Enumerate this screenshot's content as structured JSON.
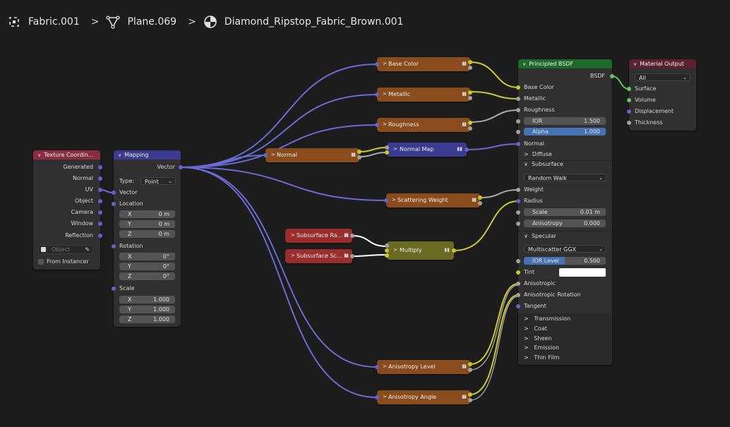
{
  "breadcrumb": {
    "object": "Fabric.001",
    "mesh": "Plane.069",
    "material": "Diamond_Ripstop_Fabric_Brown.001"
  },
  "colors": {
    "header_input": "#8a2e3f",
    "header_vector": "#3b3b8f",
    "header_shader": "#1e6a2a",
    "header_output": "#5c2231",
    "group": "#8a4b1d",
    "group_red": "#9a2d2d",
    "math": "#6a6a22",
    "wire_purple": "#6b6bd4",
    "wire_yellow": "#c9c935",
    "wire_gray": "#aaaaaa"
  },
  "texcoord": {
    "title": "Texture Coordin...",
    "outputs": [
      "Generated",
      "Normal",
      "UV",
      "Object",
      "Camera",
      "Window",
      "Reflection"
    ],
    "object_placeholder": "Object",
    "from_instancer": "From Instancer"
  },
  "mapping": {
    "title": "Mapping",
    "output": "Vector",
    "type_label": "Type:",
    "type_value": "Point",
    "vector": "Vector",
    "location": "Location",
    "location_values": [
      {
        "axis": "X",
        "v": "0 m"
      },
      {
        "axis": "Y",
        "v": "0 m"
      },
      {
        "axis": "Z",
        "v": "0 m"
      }
    ],
    "rotation": "Rotation",
    "rotation_values": [
      {
        "axis": "X",
        "v": "0°"
      },
      {
        "axis": "Y",
        "v": "0°"
      },
      {
        "axis": "Z",
        "v": "0°"
      }
    ],
    "scale": "Scale",
    "scale_values": [
      {
        "axis": "X",
        "v": "1.000"
      },
      {
        "axis": "Y",
        "v": "1.000"
      },
      {
        "axis": "Z",
        "v": "1.000"
      }
    ]
  },
  "groups": {
    "base_color": "Base Color",
    "metallic": "Metallic",
    "roughness": "Roughness",
    "normal": "Normal",
    "normal_map": "Normal Map",
    "scattering_weight": "Scattering Weight",
    "subsurface_radius": "Subsurface Ra...",
    "subsurface_scale": "Subsurface Sc...",
    "multiply": "Multiply",
    "anisotropy_level": "Anisotropy Level",
    "anisotropy_angle": "Anisotropy Angle"
  },
  "bsdf": {
    "title": "Principled BSDF",
    "output": "BSDF",
    "base_color": "Base Color",
    "metallic": "Metallic",
    "roughness": "Roughness",
    "ior_label": "IOR",
    "ior_value": "1.500",
    "alpha_label": "Alpha",
    "alpha_value": "1.000",
    "normal": "Normal",
    "diffuse": "Diffuse",
    "subsurface": "Subsurface",
    "subsurface_method": "Random Walk",
    "weight": "Weight",
    "radius": "Radius",
    "scale_label": "Scale",
    "scale_value": "0.01 m",
    "anisotropy_label": "Anisotropy",
    "anisotropy_value": "0.000",
    "specular": "Specular",
    "distribution": "Multiscatter GGX",
    "ior_level_label": "IOR Level",
    "ior_level_value": "0.500",
    "tint": "Tint",
    "anisotropic": "Anisotropic",
    "anisotropic_rotation": "Anisotropic Rotation",
    "tangent": "Tangent",
    "panels": [
      "Transmission",
      "Coat",
      "Sheen",
      "Emission",
      "Thin Film"
    ]
  },
  "output": {
    "title": "Material Output",
    "target": "All",
    "inputs": [
      "Surface",
      "Volume",
      "Displacement",
      "Thickness"
    ]
  }
}
